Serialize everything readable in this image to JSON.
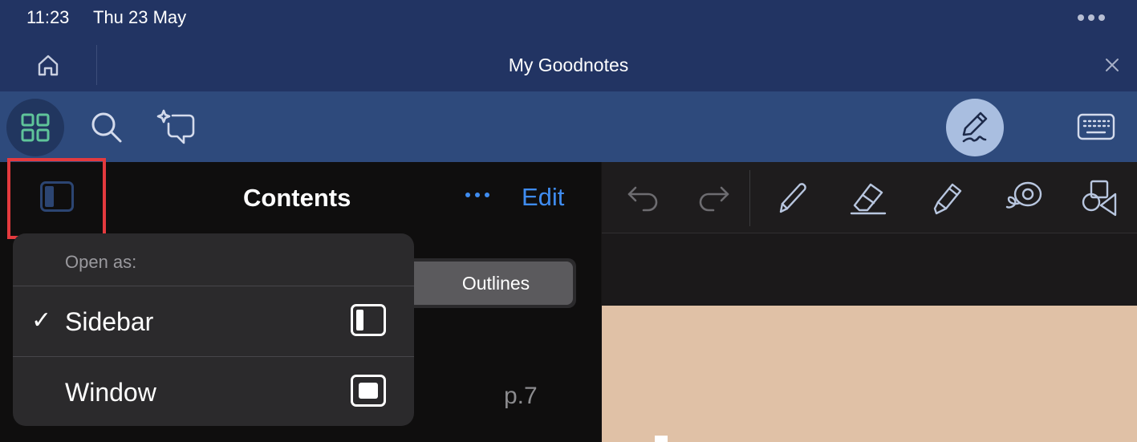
{
  "status_bar": {
    "time": "11:23",
    "date": "Thu 23 May",
    "more_icon": "ellipsis-icon"
  },
  "title_bar": {
    "home_icon": "home-icon",
    "title": "My Goodnotes",
    "close_icon": "close-icon"
  },
  "toolbar": {
    "left_items": [
      "grid-icon",
      "search-icon",
      "ai-chat-icon"
    ],
    "right_items": [
      "pen-mode-icon",
      "keyboard-icon"
    ],
    "colors": {
      "bar": "#2e4a7c",
      "grid_squares": "#5fc49a",
      "pen_mode_bg": "#a9bee0"
    }
  },
  "sidebar": {
    "title": "Contents",
    "edit_label": "Edit",
    "segment_selected": "Outlines",
    "page_number": "p.7",
    "accent_color": "#3f8cf0"
  },
  "popover": {
    "header": "Open as:",
    "options": [
      {
        "label": "Sidebar",
        "checked": true,
        "icon": "sidebar-layout-icon",
        "check": "✓"
      },
      {
        "label": "Window",
        "checked": false,
        "icon": "window-layout-icon"
      }
    ]
  },
  "editor_toolbar": {
    "tools": [
      "undo-icon",
      "redo-icon",
      "pen-icon",
      "eraser-icon",
      "highlighter-icon",
      "lasso-icon",
      "shapes-icon"
    ]
  },
  "highlight": {
    "color": "#e43a3e",
    "target": "sidebar-toggle"
  },
  "page_color": "#e0c1a6"
}
